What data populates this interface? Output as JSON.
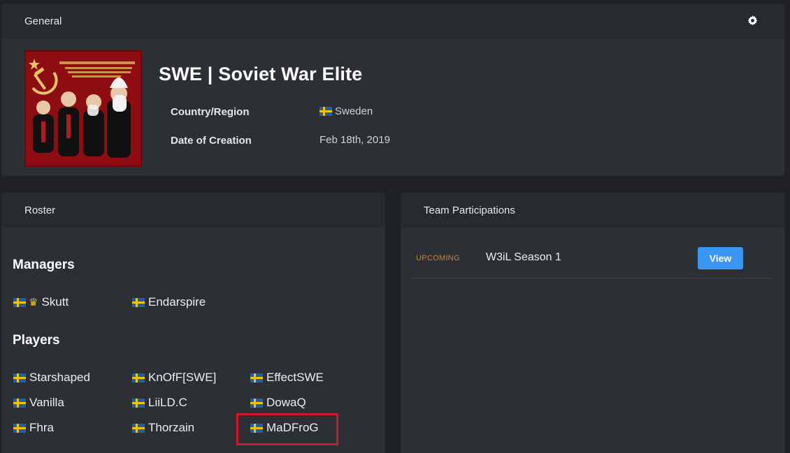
{
  "general": {
    "header": "General",
    "team_name": "SWE | Soviet War Elite",
    "country_label": "Country/Region",
    "country_value": "Sweden",
    "date_label": "Date of Creation",
    "date_value": "Feb 18th, 2019"
  },
  "roster": {
    "header": "Roster",
    "managers_title": "Managers",
    "managers": [
      "Skutt",
      "Endarspire"
    ],
    "players_title": "Players",
    "players": [
      "Starshaped",
      "KnOfF[SWE]",
      "EffectSWE",
      "Vanilla",
      "LiiLD.C",
      "DowaQ",
      "Fhra",
      "Thorzain",
      "MaDFroG"
    ]
  },
  "participations": {
    "header": "Team Participations",
    "items": [
      {
        "status": "UPCOMING",
        "name": "W3iL Season 1",
        "action": "View"
      }
    ]
  },
  "colors": {
    "accent": "#3a96f3",
    "status_upcoming": "#c9823f",
    "highlight": "#d0182b"
  },
  "icons": {
    "settings": "gear-icon",
    "flag": "sweden-flag-icon",
    "manager": "crown-icon"
  }
}
